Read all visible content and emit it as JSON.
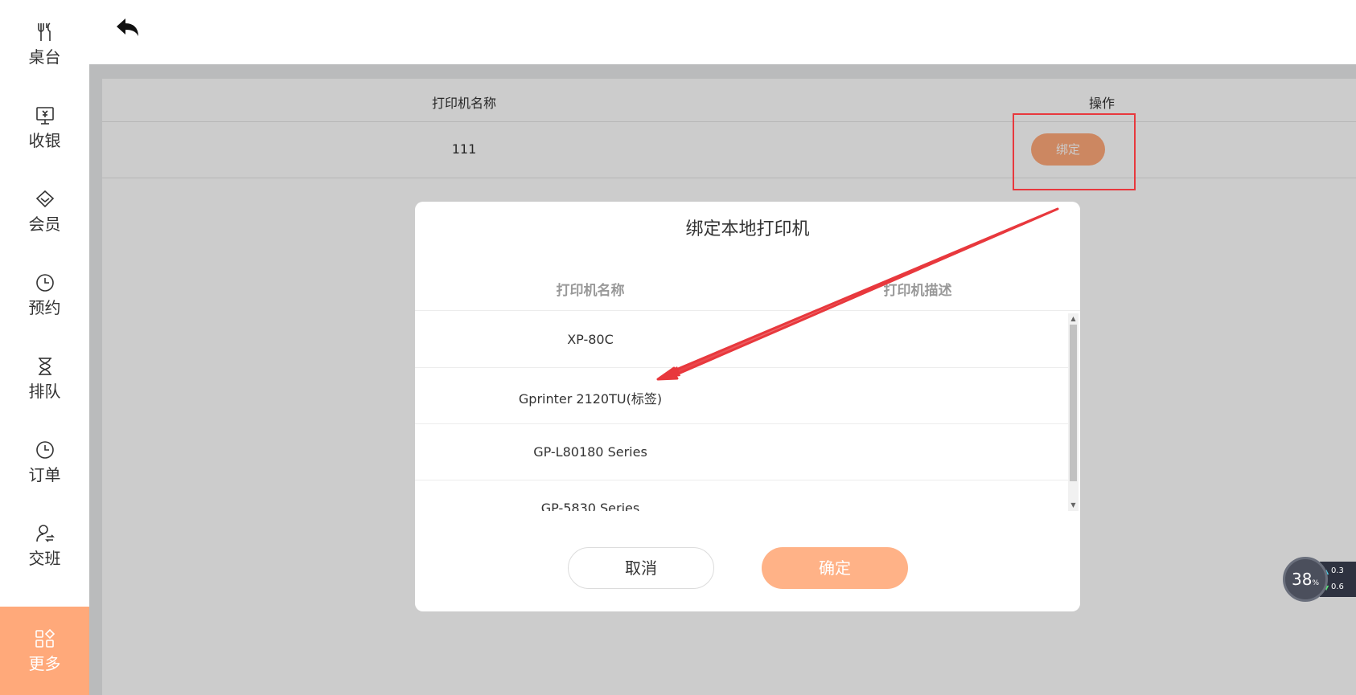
{
  "sidebar": {
    "items": [
      {
        "label": "桌台",
        "icon": "utensils-icon"
      },
      {
        "label": "收银",
        "icon": "cashier-monitor-icon"
      },
      {
        "label": "会员",
        "icon": "member-diamond-icon"
      },
      {
        "label": "预约",
        "icon": "clock-icon"
      },
      {
        "label": "排队",
        "icon": "hourglass-icon"
      },
      {
        "label": "订单",
        "icon": "clock-icon"
      },
      {
        "label": "交班",
        "icon": "user-exchange-icon"
      },
      {
        "label": "更多",
        "icon": "grid-icon"
      }
    ],
    "active_index": 7,
    "active_color": "#ffa97a"
  },
  "topbar": {
    "back_icon": "back-arrow-icon"
  },
  "printer_table": {
    "headers": {
      "name": "打印机名称",
      "action": "操作"
    },
    "rows": [
      {
        "name": "111",
        "action_label": "绑定"
      }
    ]
  },
  "dialog": {
    "title": "绑定本地打印机",
    "headers": {
      "name": "打印机名称",
      "description": "打印机描述"
    },
    "printers": [
      {
        "name": "XP-80C",
        "description": ""
      },
      {
        "name": "Gprinter 2120TU(标签)",
        "description": ""
      },
      {
        "name": "GP-L80180 Series",
        "description": ""
      },
      {
        "name": "GP-5830 Series",
        "description": ""
      }
    ],
    "cancel_label": "取消",
    "confirm_label": "确定",
    "confirm_color": "#ffb287"
  },
  "annotation": {
    "box_color": "#e8383d",
    "arrow_color": "#e8383d"
  },
  "float_widget": {
    "percent": "38",
    "percent_unit": "%",
    "up_speed": "0.3",
    "down_speed": "0.6"
  }
}
